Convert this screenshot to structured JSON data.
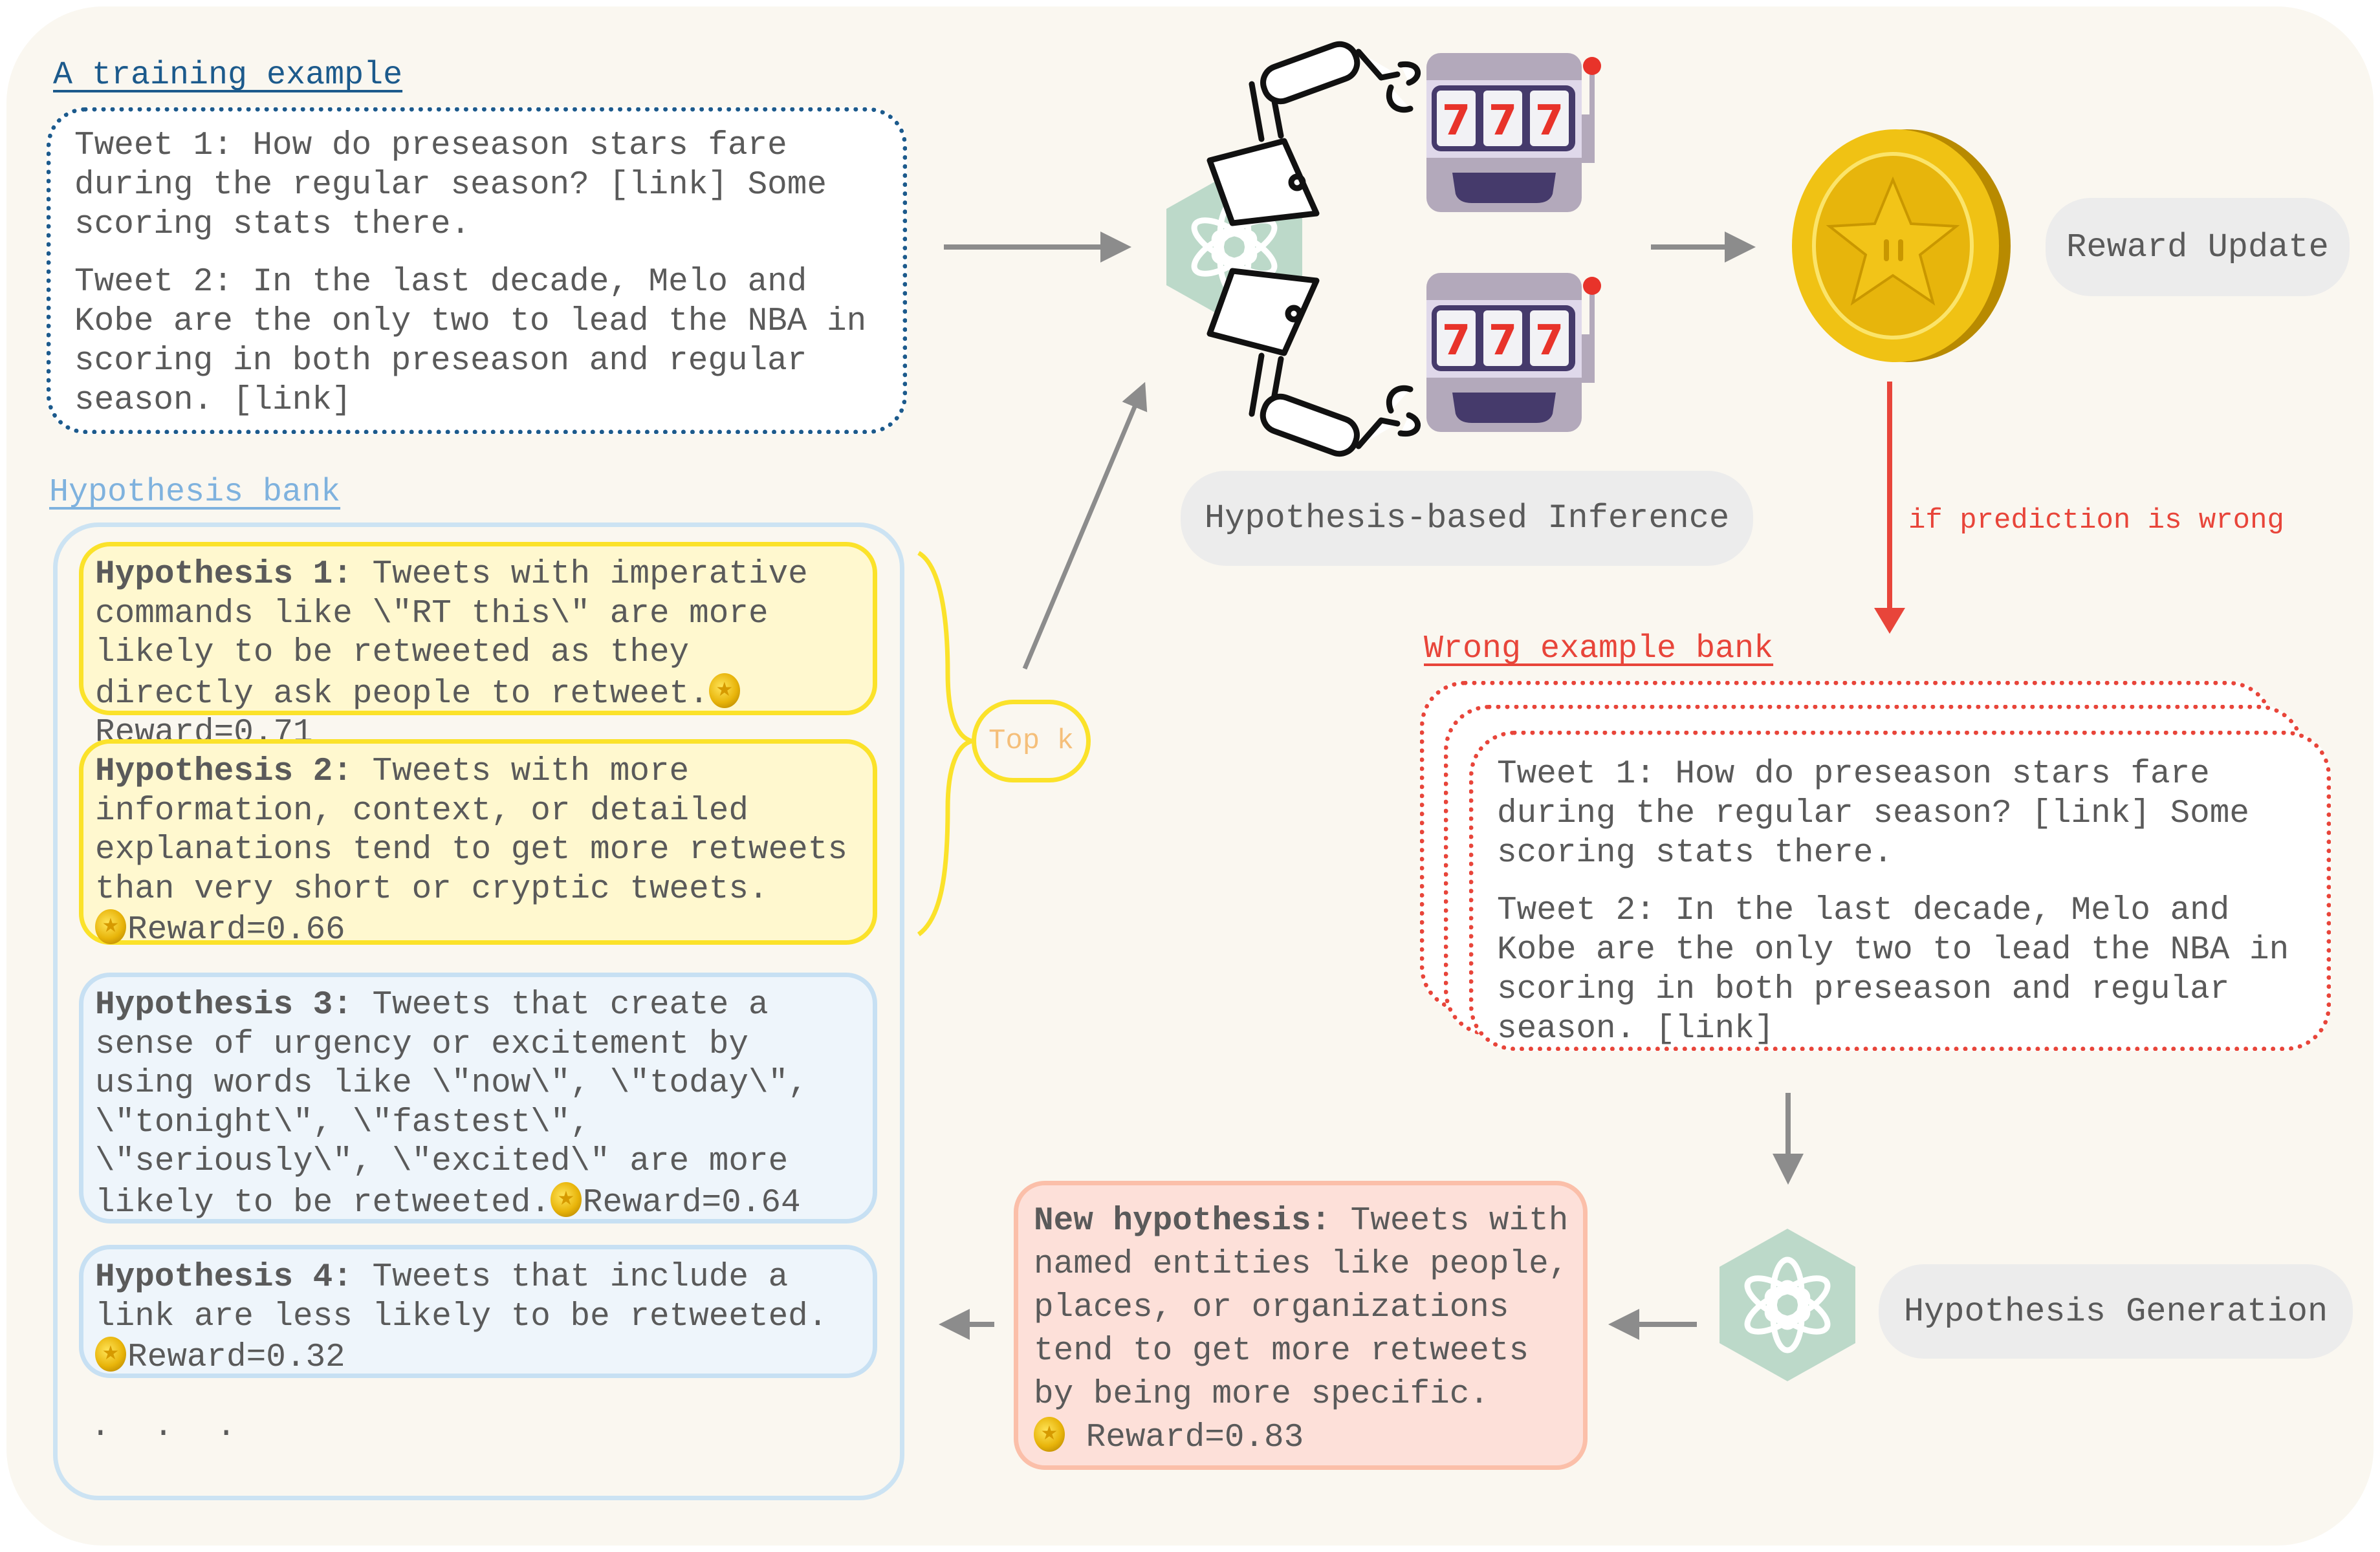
{
  "training_example": {
    "title": "A training example",
    "tweets": [
      "Tweet 1: How do preseason stars fare during the regular season? [link] Some scoring stats there.",
      "Tweet 2: In the last decade, Melo and Kobe are the only two to lead the NBA in scoring in both preseason and regular season. [link]"
    ]
  },
  "hypothesis_bank": {
    "title": "Hypothesis bank",
    "items": [
      {
        "label": "Hypothesis 1:",
        "text": " Tweets with imperative commands like \\\"RT this\\\" are more likely to be retweeted as they directly ask people to retweet.",
        "reward": "Reward=0.71",
        "selected": true
      },
      {
        "label": "Hypothesis 2:",
        "text": " Tweets with more information, context, or detailed explanations tend to get more retweets than very short or cryptic tweets.",
        "reward": "Reward=0.66",
        "selected": true
      },
      {
        "label": "Hypothesis 3:",
        "text": " Tweets that create a sense of urgency or excitement by using words like \\\"now\\\", \\\"today\\\", \\\"tonight\\\", \\\"fastest\\\", \\\"seriously\\\", \\\"excited\\\" are more likely to be retweeted.",
        "reward": "Reward=0.64",
        "selected": false
      },
      {
        "label": "Hypothesis 4:",
        "text": " Tweets that include a link are less likely to be retweeted.",
        "reward": "Reward=0.32",
        "selected": false
      }
    ],
    "ellipsis": ". . ."
  },
  "top_k_label": "Top k",
  "inference": {
    "label": "Hypothesis-based Inference",
    "icons": [
      "openai-logo-icon",
      "robot-arm-icon",
      "slot-machine-icon"
    ],
    "slot_symbols": [
      "7",
      "7",
      "7"
    ]
  },
  "reward_update": {
    "label": "Reward Update",
    "icon": "star-coin-icon"
  },
  "condition_label": "if prediction is wrong",
  "wrong_example_bank": {
    "title": "Wrong example bank",
    "tweets": [
      "Tweet 1: How do preseason stars fare during the regular season? [link] Some scoring stats there.",
      "Tweet 2: In the last decade, Melo and Kobe are the only two to lead the NBA in scoring in both preseason and regular season. [link]"
    ]
  },
  "generation": {
    "label": "Hypothesis Generation",
    "icon": "openai-logo-icon"
  },
  "new_hypothesis": {
    "label": "New hypothesis:",
    "text": " Tweets with named entities like people, places, or organizations tend to get more retweets by being more specific.",
    "reward": "Reward=0.83"
  },
  "colors": {
    "background": "#faf7f0",
    "training_border": "#1c5a8c",
    "bank_border": "#cce3f3",
    "bank_title": "#7fb2de",
    "top_hypothesis_fill": "#fff8cf",
    "top_hypothesis_border": "#fbe22a",
    "wrong_red": "#e8453a",
    "new_hypothesis_fill": "#fde0d9",
    "openai_hex": "#bcd9c9",
    "arrow_gray": "#8c8c8c"
  }
}
